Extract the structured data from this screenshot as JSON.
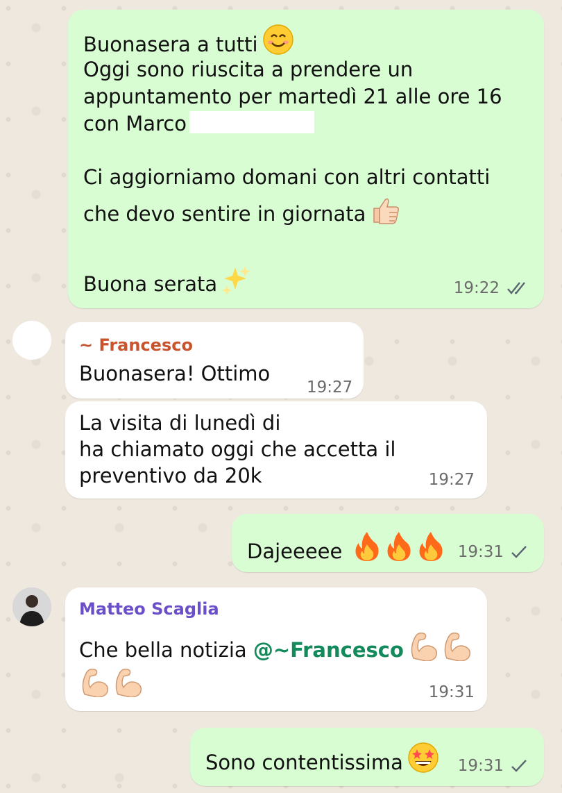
{
  "messages": {
    "m1": {
      "line1": "Buonasera a tutti",
      "line2": "Oggi sono riuscita a prendere un",
      "line3": "appuntamento per martedì 21 alle ore 16",
      "line4": "con Marco",
      "line5": "Ci aggiorniamo domani con altri contatti",
      "line6": "che devo sentire in giornata",
      "line7": "Buona serata",
      "time": "19:22",
      "status": "read-double-check"
    },
    "m2": {
      "sender": "~ Francesco",
      "sender_color": "#c8542d",
      "text": "Buonasera! Ottimo",
      "time": "19:27"
    },
    "m3": {
      "line1": "La visita di lunedì di",
      "line2": "ha chiamato oggi che accetta il",
      "line3": "preventivo da 20k",
      "time": "19:27"
    },
    "m4": {
      "text": "Dajeeeee",
      "time": "19:31",
      "status": "sent-single-check"
    },
    "m5": {
      "sender": "Matteo Scaglia",
      "sender_color": "#6a4fc8",
      "text": "Che bella notizia",
      "mention": "@~Francesco",
      "time": "19:31"
    },
    "m6": {
      "text": "Sono contentissima",
      "time": "19:31",
      "status": "sent-single-check"
    }
  },
  "icons": {
    "smile": "smiling-face-emoji",
    "thumbs": "thumbs-up-emoji",
    "sparkles": "sparkles-emoji",
    "fire": "fire-emoji",
    "muscle": "flexed-biceps-emoji",
    "starstruck": "star-struck-emoji"
  },
  "colors": {
    "outgoing_bubble": "#d9fdd3",
    "incoming_bubble": "#ffffff",
    "read_tick": "#5b6770",
    "mention": "#138a5b"
  }
}
